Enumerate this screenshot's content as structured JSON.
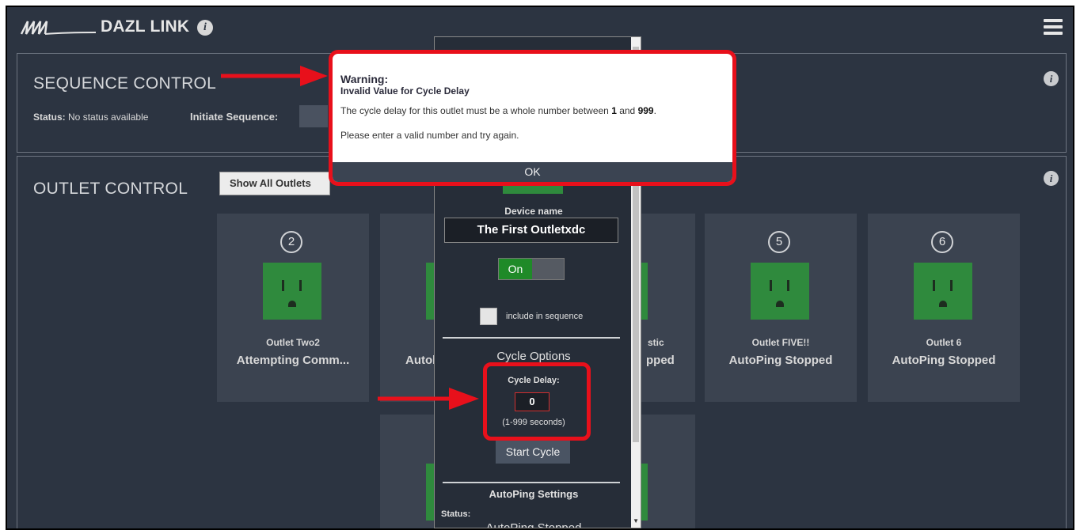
{
  "header": {
    "title": "DAZL LINK",
    "info_glyph": "i"
  },
  "sequence_panel": {
    "title": "SEQUENCE CONTROL",
    "status_label": "Status:",
    "status_value": "No status available",
    "initiate_label": "Initiate Sequence:"
  },
  "outlet_panel": {
    "title": "OUTLET CONTROL",
    "filter_value": "Show All Outlets",
    "cards": [
      {
        "number": "2",
        "name": "Outlet Two2",
        "status": "Attempting Comm..."
      },
      {
        "number": "",
        "name": "",
        "status": "Autol"
      },
      {
        "number": "",
        "name": "stic",
        "status": "pped"
      },
      {
        "number": "5",
        "name": "Outlet FIVE!!",
        "status": "AutoPing Stopped"
      },
      {
        "number": "6",
        "name": "Outlet 6",
        "status": "AutoPing Stopped"
      }
    ]
  },
  "device_dialog": {
    "device_name_label": "Device name",
    "device_name_value": "The First Outletxdc",
    "toggle_label": "On",
    "sequence_checkbox_label": "include in sequence",
    "cycle_options_title": "Cycle Options",
    "cycle_delay_label": "Cycle Delay:",
    "cycle_delay_value": "0",
    "cycle_delay_range": "(1-999 seconds)",
    "start_cycle_label": "Start Cycle",
    "autoping_title": "AutoPing Settings",
    "autoping_status_label": "Status:",
    "autoping_status_value": "AutoPing Stopped"
  },
  "warning": {
    "title": "Warning:",
    "subtitle": "Invalid Value for Cycle Delay",
    "message_prefix": "The cycle delay for this outlet must be a whole number between ",
    "min": "1",
    "message_mid": " and ",
    "max": "999",
    "message_suffix": ".",
    "message2": "Please enter a valid number and try again.",
    "ok_label": "OK"
  },
  "colors": {
    "highlight": "#e8101b",
    "outlet_green": "#2f8a3d",
    "background": "#2c3441"
  }
}
